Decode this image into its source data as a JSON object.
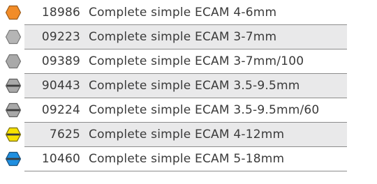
{
  "items": [
    {
      "code": "18986",
      "description": "Complete simple ECAM 4-6mm",
      "icon": "orange-hexagon-icon",
      "fill": "#f28c28",
      "stroke": "#9a5a1a",
      "band": false,
      "shaded": false
    },
    {
      "code": "09223",
      "description": "Complete simple ECAM 3-7mm",
      "icon": "grey-hexagon-icon",
      "fill": "#b5b5b5",
      "stroke": "#7a7a7a",
      "band": false,
      "shaded": true
    },
    {
      "code": "09389",
      "description": "Complete simple ECAM 3-7mm/100",
      "icon": "grey-hexagon-icon",
      "fill": "#a9a9a9",
      "stroke": "#707070",
      "band": false,
      "shaded": false
    },
    {
      "code": "90443",
      "description": "Complete simple ECAM 3.5-9.5mm",
      "icon": "grey-banded-hexagon-icon",
      "fill": "#a9a9a9",
      "stroke": "#5e5e5e",
      "band": true,
      "shaded": true
    },
    {
      "code": "09224",
      "description": "Complete simple ECAM 3.5-9.5mm/60",
      "icon": "grey-banded-hexagon-icon",
      "fill": "#a9a9a9",
      "stroke": "#5e5e5e",
      "band": true,
      "shaded": false
    },
    {
      "code": "7625",
      "description": "Complete simple ECAM 4-12mm",
      "icon": "yellow-banded-hexagon-icon",
      "fill": "#f7e200",
      "stroke": "#7a6d00",
      "band": true,
      "shaded": true
    },
    {
      "code": "10460",
      "description": "Complete simple ECAM 5-18mm",
      "icon": "blue-banded-hexagon-icon",
      "fill": "#1f8fe0",
      "stroke": "#1a4f7a",
      "band": true,
      "shaded": false
    }
  ]
}
